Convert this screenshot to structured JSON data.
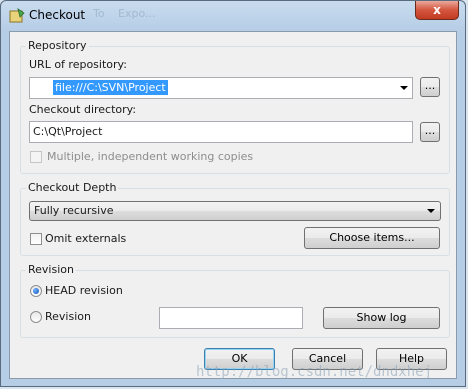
{
  "window": {
    "title": "Checkout",
    "close_glyph": "x",
    "ghost_items": [
      "To",
      "Expo..."
    ]
  },
  "repository": {
    "group_label": "Repository",
    "url_label": "URL of repository:",
    "url_value": "file:///C:\\SVN\\Project",
    "url_browse": "...",
    "dir_label": "Checkout directory:",
    "dir_value": "C:\\Qt\\Project",
    "dir_browse": "...",
    "multiple_label": "Multiple, independent working copies",
    "multiple_checked": false,
    "multiple_enabled": false
  },
  "depth": {
    "group_label": "Checkout Depth",
    "selected": "Fully recursive",
    "omit_externals_label": "Omit externals",
    "omit_externals_checked": false,
    "choose_items_label": "Choose items..."
  },
  "revision": {
    "group_label": "Revision",
    "head_label": "HEAD revision",
    "revision_label": "Revision",
    "revision_value": "",
    "selected": "head",
    "show_log_label": "Show log"
  },
  "buttons": {
    "ok": "OK",
    "cancel": "Cancel",
    "help": "Help"
  },
  "watermark": "http://blog.csdn.net/dndxhej"
}
